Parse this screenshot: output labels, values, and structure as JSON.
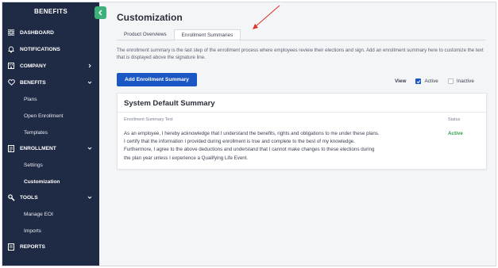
{
  "sidebar": {
    "title": "BENEFITS",
    "items": [
      {
        "label": "DASHBOARD",
        "icon": "grid-icon"
      },
      {
        "label": "NOTIFICATIONS",
        "icon": "bell-icon"
      },
      {
        "label": "COMPANY",
        "icon": "building-icon"
      },
      {
        "label": "BENEFITS",
        "icon": "heart-icon"
      },
      {
        "label": "ENROLLMENT",
        "icon": "form-icon"
      },
      {
        "label": "TOOLS",
        "icon": "wrench-icon"
      },
      {
        "label": "REPORTS",
        "icon": "report-icon"
      }
    ],
    "benefits_sub": [
      "Plans",
      "Open Enrollment",
      "Templates"
    ],
    "enrollment_sub": [
      "Settings",
      "Customization"
    ],
    "tools_sub": [
      "Manage EOI",
      "Imports"
    ]
  },
  "main": {
    "title": "Customization",
    "tabs": [
      "Product Overviews",
      "Enrollment Summaries"
    ],
    "description": "The enrollment summary is the last step of the enrollment process where employees review their elections and sign. Add an enrollment summary here to customize the text that is displayed above the signature line.",
    "add_button": "Add Enrollment Summary",
    "view": {
      "label": "View",
      "active": "Active",
      "inactive": "Inactive",
      "active_checked": true,
      "inactive_checked": false
    }
  },
  "card": {
    "title": "System Default Summary",
    "col_text": "Enrollment Summary Text",
    "col_status": "Status",
    "lines": [
      "As an employee, I hereby acknowledge that I understand the benefits, rights and obligations to me under these plans.",
      "I certify that the information I provided during enrollment is true and complete to the best of my knowledge.",
      "Furthermore, I agree to the above deductions and understand that I cannot make changes to these elections during",
      "the plan year unless I experience a Qualifying Life Event."
    ],
    "status": "Active"
  },
  "colors": {
    "sidebar": "#1f2a44",
    "accent_green": "#3fb07a",
    "button_blue": "#1a56c4",
    "status_green": "#2f9e4f",
    "annotation_red": "#e0332b"
  }
}
